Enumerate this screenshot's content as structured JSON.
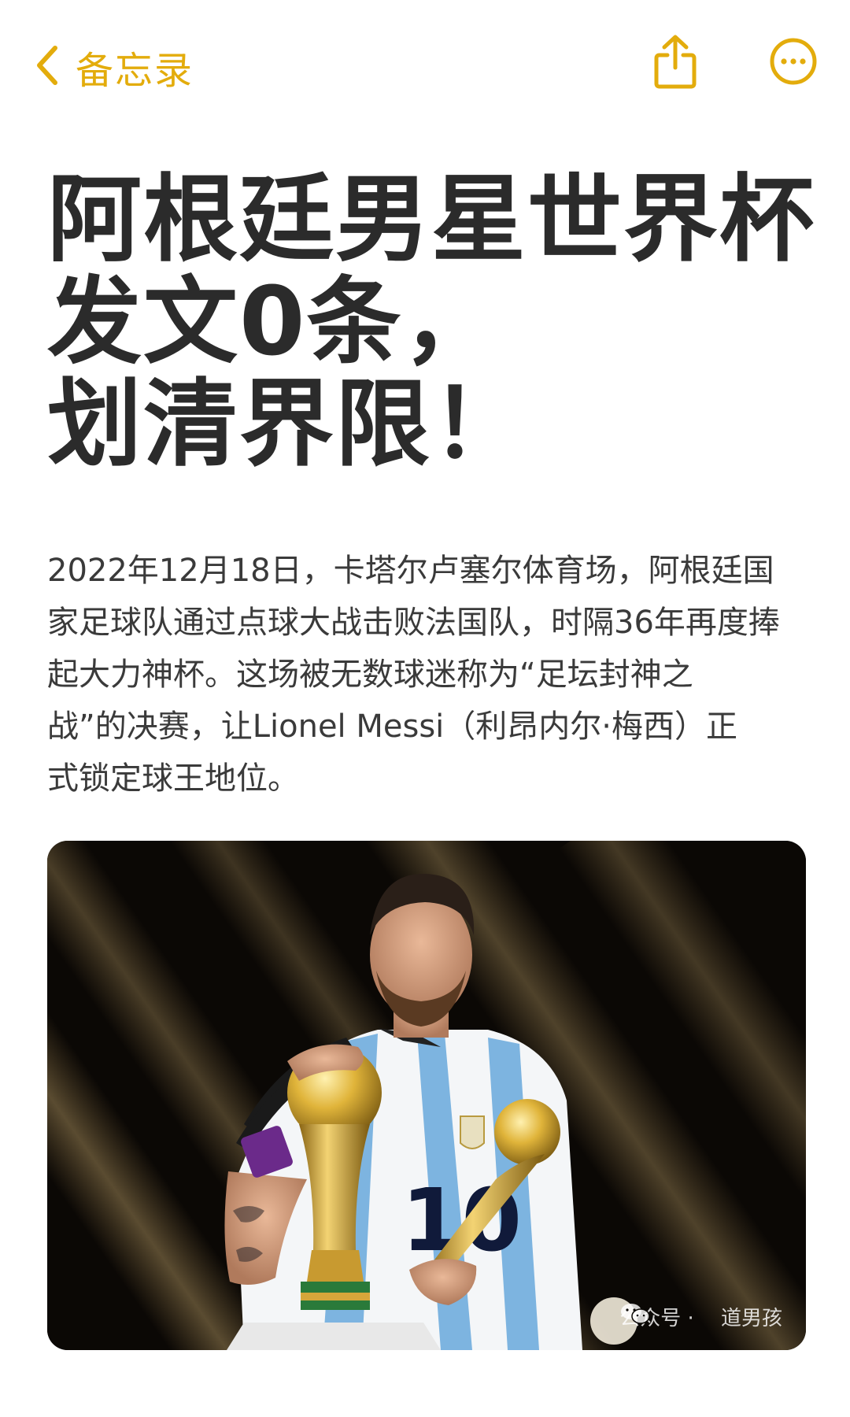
{
  "nav": {
    "back_label": "备忘录",
    "accent_color": "#e3ac0c",
    "icons": [
      "chevron-left-icon",
      "share-icon",
      "more-icon"
    ]
  },
  "note": {
    "title_lines": [
      "阿根廷男星世界杯",
      "发文0条，",
      "划清界限！"
    ],
    "body_lines": [
      "2022年12月18日，卡塔尔卢塞尔体育场，阿根廷国",
      "家足球队通过点球大战击败法国队，时隔36年再度捧",
      "起大力神杯。这场被无数球迷称为“足坛封神之",
      "战”的决赛，让Lionel Messi（利昂内尔·梅西）正",
      "式锁定球王地位。"
    ]
  },
  "photo": {
    "watermark": "公众号 · 　道男孩",
    "watermark_icon": "wechat-icon"
  }
}
